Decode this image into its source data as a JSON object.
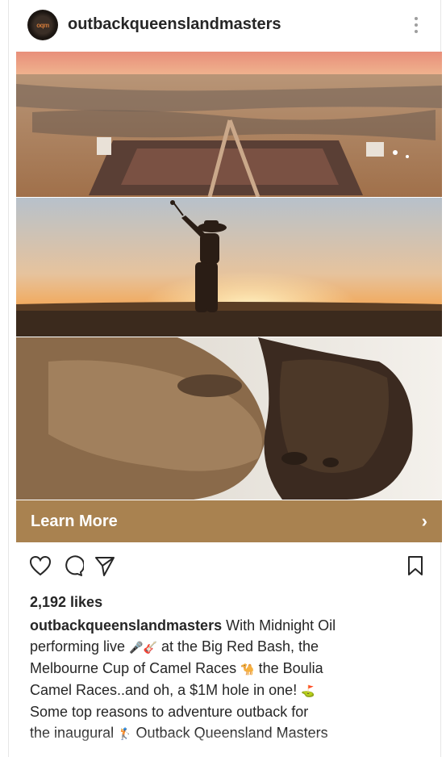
{
  "post": {
    "username": "outbackqueenslandmasters",
    "avatar_icon": "outback-masters-logo",
    "more_icon": "more-vertical-icon"
  },
  "images": [
    {
      "name": "crowd-aerial-photo"
    },
    {
      "name": "golfer-sunset-photo"
    },
    {
      "name": "camels-photo"
    }
  ],
  "cta": {
    "label": "Learn More",
    "chevron": "›",
    "color": "#a98250"
  },
  "actions": {
    "like_icon": "heart-icon",
    "comment_icon": "comment-icon",
    "share_icon": "send-icon",
    "save_icon": "bookmark-icon"
  },
  "likes": "2,192 likes",
  "caption": {
    "author": "outbackqueenslandmasters",
    "line1": " With Midnight Oil",
    "line2": "performing live",
    "line2b": " at the Big Red Bash, the",
    "line3": "Melbourne Cup of Camel Races",
    "line3b": " the Boulia",
    "line4": "Camel Races..and oh, a $1M hole in one!",
    "line5": "Some top reasons to adventure outback for",
    "line6": "the inaugural",
    "line6b": " Outback Queensland Masters"
  }
}
